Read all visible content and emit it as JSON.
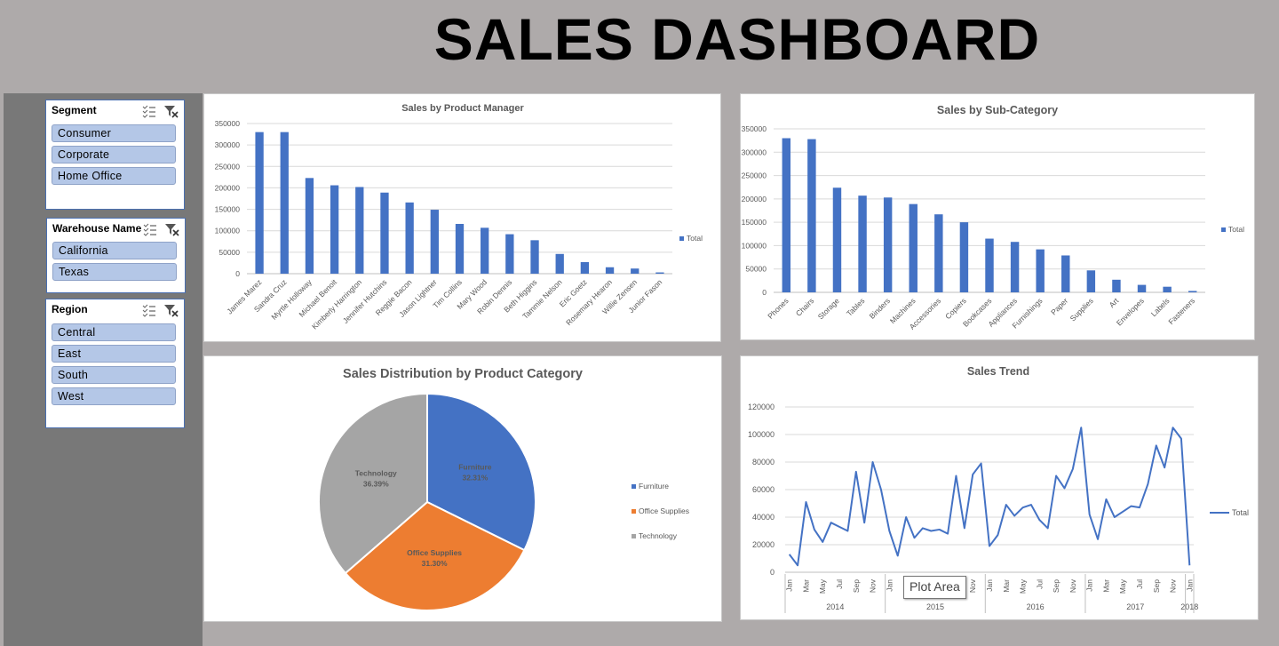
{
  "dashboard": {
    "title": "SALES DASHBOARD"
  },
  "slicers": {
    "segment": {
      "title": "Segment",
      "items": [
        "Consumer",
        "Corporate",
        "Home Office"
      ]
    },
    "warehouse": {
      "title": "Warehouse Name",
      "items": [
        "California",
        "Texas"
      ]
    },
    "region": {
      "title": "Region",
      "items": [
        "Central",
        "East",
        "South",
        "West"
      ]
    },
    "icons": [
      "multi-select-icon",
      "clear-filter-icon"
    ]
  },
  "tooltip": {
    "text": "Plot Area"
  },
  "colors": {
    "blue": "#4472c4",
    "orange": "#ed7d31",
    "gray": "#a5a5a5",
    "slicer_item": "#b4c7e7"
  },
  "chart_data": [
    {
      "id": "manager",
      "type": "bar",
      "title": "Sales by Product Manager",
      "categories": [
        "James Marez",
        "Sandra Cruz",
        "Myrtle Holloway",
        "Michael Benoit",
        "Kimberly Harrington",
        "Jennifer Hutchins",
        "Reggie Bacon",
        "Jason Lightner",
        "Tim Collins",
        "Mary Wood",
        "Robin Dennis",
        "Beth Higgins",
        "Tammie Nelson",
        "Eric Goetz",
        "Rosemary Hearon",
        "Willie Zensen",
        "Junior Fason"
      ],
      "series": [
        {
          "name": "Total",
          "values": [
            330000,
            330000,
            223000,
            206000,
            202000,
            189000,
            166000,
            149000,
            116000,
            107000,
            92000,
            78000,
            46000,
            27000,
            15000,
            12000,
            3000
          ]
        }
      ],
      "yticks": [
        "0",
        "50000",
        "100000",
        "150000",
        "200000",
        "250000",
        "300000",
        "350000"
      ],
      "ylim": [
        0,
        350000
      ],
      "legend": "right",
      "grid": true
    },
    {
      "id": "subcat",
      "type": "bar",
      "title": "Sales by Sub-Category",
      "categories": [
        "Phones",
        "Chairs",
        "Storage",
        "Tables",
        "Binders",
        "Machines",
        "Accessories",
        "Copiers",
        "Bookcases",
        "Appliances",
        "Furnishings",
        "Paper",
        "Supplies",
        "Art",
        "Envelopes",
        "Labels",
        "Fasteners"
      ],
      "series": [
        {
          "name": "Total",
          "values": [
            330000,
            328000,
            224000,
            207000,
            203000,
            189000,
            167000,
            150000,
            115000,
            108000,
            92000,
            79000,
            47000,
            27000,
            16000,
            12000,
            3000
          ]
        }
      ],
      "yticks": [
        "0",
        "50000",
        "100000",
        "150000",
        "200000",
        "250000",
        "300000",
        "350000"
      ],
      "ylim": [
        0,
        350000
      ],
      "legend": "right",
      "grid": true
    },
    {
      "id": "category",
      "type": "pie",
      "title": "Sales Distribution by Product Category",
      "labels": [
        "Furniture",
        "Office Supplies",
        "Technology"
      ],
      "pct_labels": [
        "32.31%",
        "31.30%",
        "36.39%"
      ],
      "values": [
        32.31,
        31.3,
        36.39
      ],
      "colors": [
        "#4472c4",
        "#ed7d31",
        "#a5a5a5"
      ],
      "legend": "right"
    },
    {
      "id": "trend",
      "type": "line",
      "title": "Sales Trend",
      "series": [
        {
          "name": "Total",
          "values": [
            13000,
            5000,
            51000,
            31000,
            22000,
            36000,
            33000,
            30000,
            73000,
            36000,
            80000,
            60000,
            30000,
            12000,
            40000,
            25000,
            32000,
            30000,
            31000,
            28000,
            70000,
            32000,
            71000,
            79000,
            19000,
            27000,
            49000,
            41000,
            47000,
            49000,
            38000,
            32000,
            70000,
            61000,
            75000,
            105000,
            42000,
            24000,
            53000,
            40000,
            44000,
            48000,
            47000,
            64000,
            92000,
            76000,
            105000,
            97000,
            5000
          ]
        }
      ],
      "month_labels": [
        "Jan",
        "Mar",
        "May",
        "Jul",
        "Sep",
        "Nov"
      ],
      "year_labels": [
        "2014",
        "2015",
        "2016",
        "2017",
        "2018"
      ],
      "yticks": [
        "0",
        "20000",
        "40000",
        "60000",
        "80000",
        "100000",
        "120000"
      ],
      "ylim": [
        0,
        120000
      ],
      "legend": "right",
      "grid": true
    }
  ]
}
